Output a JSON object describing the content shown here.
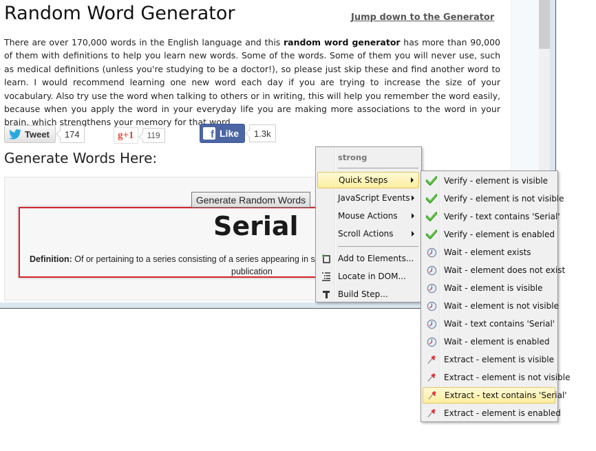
{
  "page": {
    "title": "Random Word Generator",
    "jump_link": "Jump down to the Generator",
    "intro_part1": "There are over 170,000 words in the English language and this ",
    "intro_bold": "random word generator",
    "intro_part2": " has more than 90,000 of them with definitions to help you learn new words. Some of the words. Some of them you will never use, such as medical definitions (unless you're studying to be a doctor!), so please just skip these and find another word to learn. I would recommend learning one new word each day if you are trying to increase the size of your vocabulary. Also try use the word when talking to others or in writing, this will help you remember the word easily, because when you apply the word in your everyday life you are making more associations to the word in your brain, which strengthens your memory for that word."
  },
  "social": {
    "tweet_label": "Tweet",
    "tweet_count": "174",
    "gplus_label": "g+1",
    "gplus_count": "119",
    "like_label": "Like",
    "like_count": "1.3k"
  },
  "generator": {
    "heading": "Generate Words Here:",
    "button_label": "Generate Random Words",
    "word": "Serial",
    "definition_label": "Definition:",
    "definition_line1": " Of or pertaining to a series consisting of a series appearing in suc",
    "definition_line2": "publication"
  },
  "context_menu": {
    "header": "strong",
    "items": [
      {
        "label": "Quick Steps",
        "submenu": true,
        "highlighted": true
      },
      {
        "label": "JavaScript Events",
        "submenu": true
      },
      {
        "label": "Mouse Actions",
        "submenu": true
      },
      {
        "label": "Scroll Actions",
        "submenu": true
      },
      {
        "label": "Add to Elements...",
        "icon": "add-element-icon"
      },
      {
        "label": "Locate in DOM...",
        "icon": "locate-dom-icon"
      },
      {
        "label": "Build Step...",
        "icon": "hammer-icon"
      }
    ]
  },
  "quick_steps_menu": {
    "items": [
      {
        "label": "Verify - element is visible",
        "icon": "check-icon"
      },
      {
        "label": "Verify - element is not visible",
        "icon": "check-icon"
      },
      {
        "label": "Verify - text contains 'Serial'",
        "icon": "check-icon"
      },
      {
        "label": "Verify - element is enabled",
        "icon": "check-icon"
      },
      {
        "label": "Wait - element exists",
        "icon": "clock-icon"
      },
      {
        "label": "Wait - element does not exist",
        "icon": "clock-icon"
      },
      {
        "label": "Wait - element is visible",
        "icon": "clock-icon"
      },
      {
        "label": "Wait - element is not visible",
        "icon": "clock-icon"
      },
      {
        "label": "Wait - text contains 'Serial'",
        "icon": "clock-icon"
      },
      {
        "label": "Wait - element is enabled",
        "icon": "clock-icon"
      },
      {
        "label": "Extract - element is visible",
        "icon": "pushpin-icon"
      },
      {
        "label": "Extract - element is not visible",
        "icon": "pushpin-icon"
      },
      {
        "label": "Extract - text contains 'Serial'",
        "icon": "pushpin-icon",
        "highlighted": true
      },
      {
        "label": "Extract - element is enabled",
        "icon": "pushpin-icon"
      }
    ]
  },
  "colors": {
    "highlight_border": "#e5c365",
    "word_box_border": "#d3262b",
    "facebook_blue": "#4c66a4",
    "gplus_red": "#dd4b39",
    "twitter_blue": "#2aa9e0"
  }
}
